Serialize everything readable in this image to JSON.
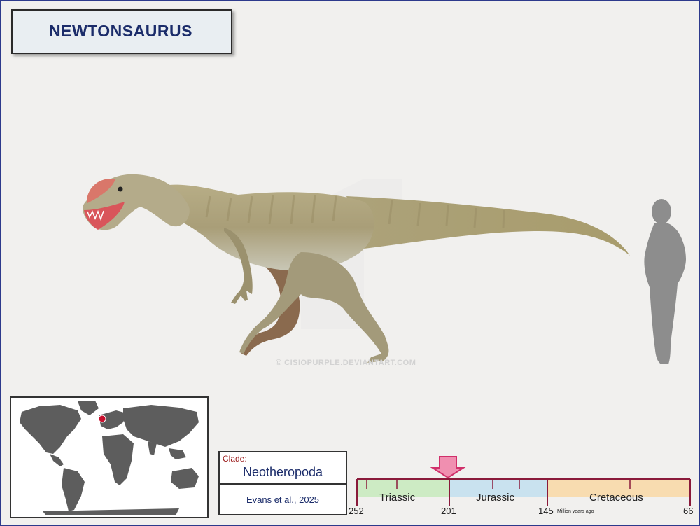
{
  "title": "NEWTONSAURUS",
  "watermark": "© CISIOPURPLE.DEVIANTART.COM",
  "clade": {
    "label": "Clade:",
    "value": "Neotheropoda",
    "reference": "Evans et al., 2025"
  },
  "timeline": {
    "periods": [
      "Triassic",
      "Jurassic",
      "Cretaceous"
    ],
    "ticks": [
      "252",
      "201",
      "145",
      "66"
    ],
    "unit": "Million years ago",
    "marker_mya": 201,
    "colors": {
      "triassic": "#cdebc4",
      "jurassic": "#c9e2ef",
      "cretaceous": "#f8dcb0",
      "axis": "#8a1a3a",
      "marker": "#e85a8a"
    }
  },
  "map": {
    "location_dot_color": "#c8102e"
  },
  "icons": [
    "dinosaur-illustration",
    "human-silhouette-icon",
    "world-map-icon",
    "location-dot-icon",
    "down-arrow-marker-icon"
  ]
}
